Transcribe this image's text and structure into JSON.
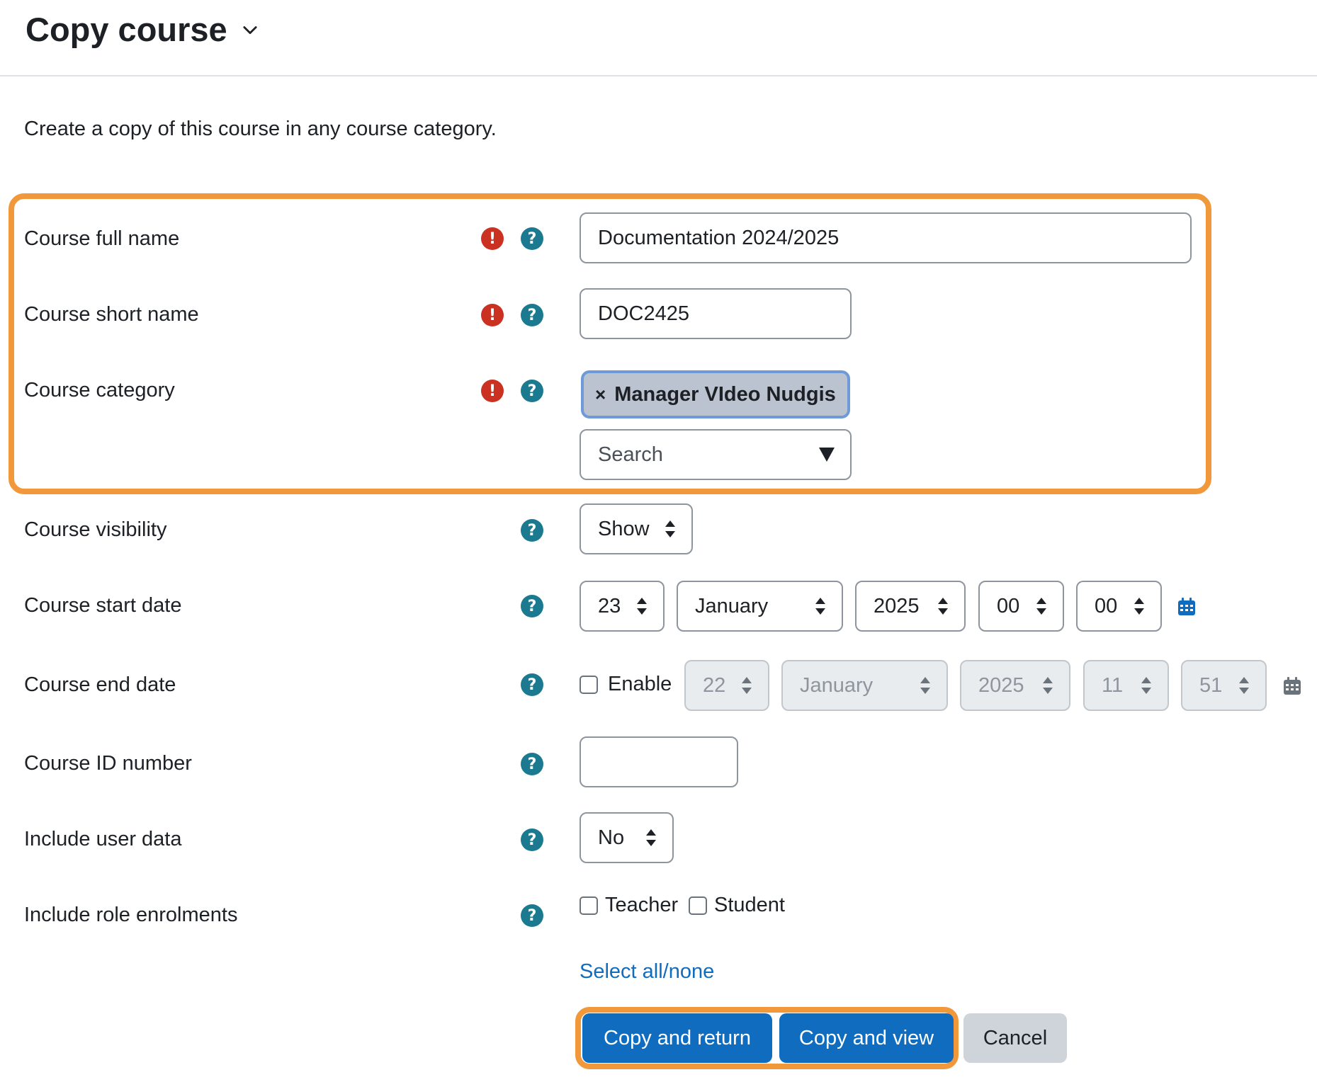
{
  "header": {
    "title": "Copy course"
  },
  "intro": "Create a copy of this course in any course category.",
  "fields": {
    "fullname": {
      "label": "Course full name",
      "value": "Documentation 2024/2025"
    },
    "shortname": {
      "label": "Course short name",
      "value": "DOC2425"
    },
    "category": {
      "label": "Course category",
      "selected": "Manager VIdeo Nudgis",
      "placeholder": "Search"
    },
    "visibility": {
      "label": "Course visibility",
      "value": "Show"
    },
    "startdate": {
      "label": "Course start date",
      "day": "23",
      "month": "January",
      "year": "2025",
      "hour": "00",
      "minute": "00"
    },
    "enddate": {
      "label": "Course end date",
      "enable_label": "Enable",
      "day": "22",
      "month": "January",
      "year": "2025",
      "hour": "11",
      "minute": "51"
    },
    "idnumber": {
      "label": "Course ID number",
      "value": ""
    },
    "userdata": {
      "label": "Include user data",
      "value": "No"
    },
    "roles": {
      "label": "Include role enrolments",
      "options": [
        "Teacher",
        "Student"
      ],
      "select_all": "Select all/none"
    }
  },
  "buttons": {
    "copy_return": "Copy and return",
    "copy_view": "Copy and view",
    "cancel": "Cancel"
  },
  "colors": {
    "primary": "#0f6cbf",
    "required": "#ca3120",
    "help": "#1b7a8f",
    "highlight": "#f0983a"
  },
  "icons": {
    "required": "exclamation-icon",
    "help": "question-icon",
    "calendar": "calendar-icon"
  }
}
